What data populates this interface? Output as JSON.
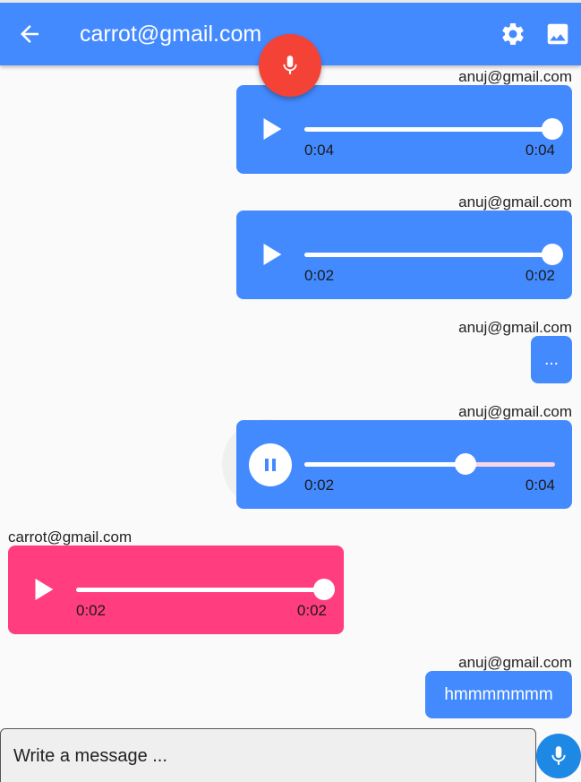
{
  "header": {
    "title": "carrot@gmail.com",
    "back_icon": "arrow-back-icon",
    "settings_icon": "gear-icon",
    "image_icon": "image-icon",
    "record_icon": "mic-icon"
  },
  "colors": {
    "primary": "#448aff",
    "fab": "#f44336",
    "pink": "#ff3d7f",
    "send_button": "#1e88e5"
  },
  "messages": [
    {
      "sender": "anuj@gmail.com",
      "kind": "audio",
      "state": "paused",
      "current": "0:04",
      "total": "0:04",
      "progress": 1.0
    },
    {
      "sender": "anuj@gmail.com",
      "kind": "audio",
      "state": "paused",
      "current": "0:02",
      "total": "0:02",
      "progress": 1.0
    },
    {
      "sender": "anuj@gmail.com",
      "kind": "text",
      "text": "..."
    },
    {
      "sender": "anuj@gmail.com",
      "kind": "audio",
      "state": "playing",
      "current": "0:02",
      "total": "0:04",
      "progress": 0.64
    },
    {
      "sender": "carrot@gmail.com",
      "kind": "audio",
      "state": "paused",
      "current": "0:02",
      "total": "0:02",
      "progress": 1.0
    },
    {
      "sender": "anuj@gmail.com",
      "kind": "text",
      "text": "hmmmmmmm"
    }
  ],
  "composer": {
    "placeholder": "Write a message ...",
    "send_icon": "mic-icon"
  }
}
